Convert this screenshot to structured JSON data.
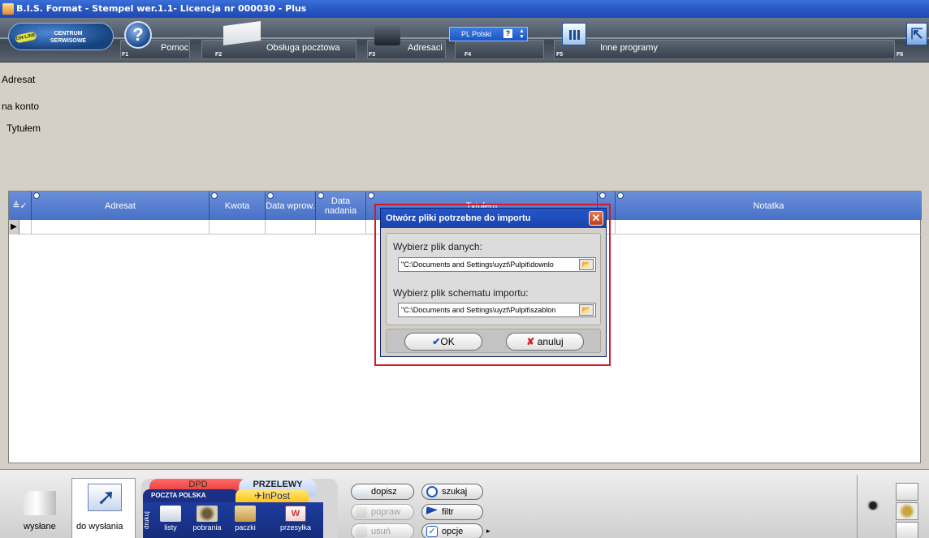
{
  "window": {
    "title": "B.I.S. Format - Stempel wer.1.1- Licencja nr 000030 - Plus"
  },
  "toolbar": {
    "centrum": {
      "line1": "CENTRUM",
      "line2": "SERWISOWE",
      "online": "ON-LINE"
    },
    "items": [
      {
        "label": "Pomoc",
        "fkey": "F1"
      },
      {
        "label": "Obsługa pocztowa",
        "fkey": "F2"
      },
      {
        "label": "Adresaci",
        "fkey": "F3"
      },
      {
        "label": "",
        "fkey": "F4"
      },
      {
        "label": "Inne programy",
        "fkey": "F5"
      },
      {
        "label": "",
        "fkey": "F6"
      }
    ],
    "language": "PL Polski",
    "language_help": "?"
  },
  "form": {
    "adresat": "Adresat",
    "na_konto": "na konto",
    "tytulem": "Tytułem"
  },
  "grid": {
    "columns": [
      "Adresat",
      "Kwota",
      "Data wprow.",
      "Data nadania",
      "Tytułem",
      "",
      "Notatka"
    ],
    "sort_icons": "≜✓"
  },
  "dialog": {
    "title": "Otwórz pliki potrzebne do importu",
    "data_file_label": "Wybierz plik danych:",
    "data_file_value": "\"C:\\Documents and Settings\\uyzt\\Pulpit\\downlo",
    "schema_file_label": "Wybierz plik schematu importu:",
    "schema_file_value": "\"C:\\Documents and Settings\\uyzt\\Pulpit\\szablon",
    "ok_label": "OK",
    "cancel_label": "anuluj"
  },
  "bottom": {
    "sent": "wysłane",
    "to_send": "do wysłania",
    "tabs": {
      "dpd": "DPD",
      "przelewy": "PRZELEWY",
      "poczta": "POCZTA POLSKA",
      "inpost": "InPost",
      "drukuj": "drukuj"
    },
    "tab_items": [
      "listy",
      "pobrania",
      "paczki",
      "przesyłka"
    ],
    "actions": {
      "dopisz": "dopisz",
      "popraw": "popraw",
      "usun": "usuń",
      "szukaj": "szukaj",
      "filtr": "filtr",
      "opcje": "opcje"
    }
  },
  "colors": {
    "title_blue": "#2a58c4",
    "grid_header": "#5a80d0",
    "dialog_highlight": "#d01a2a",
    "cancel_x": "#d4201c"
  }
}
